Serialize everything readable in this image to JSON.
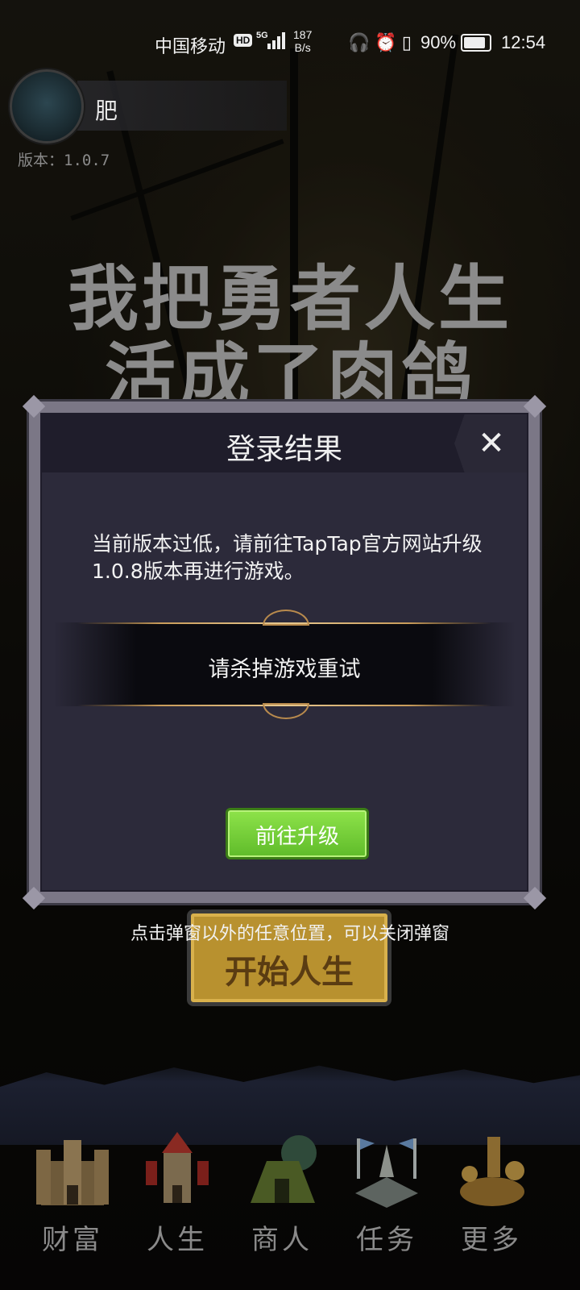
{
  "status_bar": {
    "carrier": "中国移动",
    "hd_badge": "HD",
    "network": "5G",
    "speed_value": "187",
    "speed_unit": "B/s",
    "battery": "90%",
    "time": "12:54"
  },
  "player": {
    "name": "肥",
    "version": "版本：1.0.7"
  },
  "game_title": {
    "line1": "我把勇者人生",
    "line2": "活成了肉鸽"
  },
  "start_button": {
    "label": "开始人生"
  },
  "modal": {
    "title": "登录结果",
    "message": "当前版本过低，请前往TapTap官方网站升级1.0.8版本再进行游戏。",
    "banner_text": "请杀掉游戏重试",
    "upgrade_button": "前往升级"
  },
  "hint": "点击弹窗以外的任意位置，可以关闭弹窗",
  "bottom_nav": {
    "items": [
      {
        "label": "财富",
        "icon": "castle-icon"
      },
      {
        "label": "人生",
        "icon": "tower-icon"
      },
      {
        "label": "商人",
        "icon": "merchant-tent-icon"
      },
      {
        "label": "任务",
        "icon": "quest-altar-icon"
      },
      {
        "label": "更多",
        "icon": "workshop-icon"
      }
    ]
  }
}
